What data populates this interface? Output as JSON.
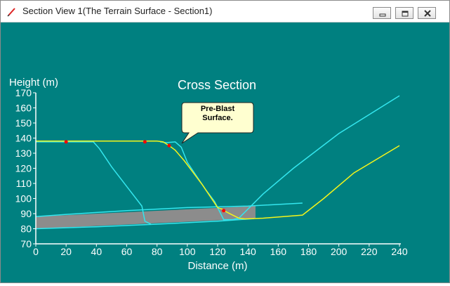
{
  "window": {
    "title": "Section View 1(The Terrain Surface - Section1)"
  },
  "title_buttons": [
    "minimize-icon",
    "restore-icon",
    "close-icon"
  ],
  "colors": {
    "background": "#008080",
    "surface_cyan": "#33e6ee",
    "surface_yellow": "#f5f51a",
    "layer_fill": "#8c8c8c",
    "marker_red": "#ff0000",
    "callout_fill": "#ffffd0"
  },
  "callout": {
    "line1": "Pre-Blast",
    "line2": "Surface."
  },
  "chart_data": {
    "type": "line",
    "title": "Cross Section",
    "xlabel": "Distance (m)",
    "ylabel": "Height (m)",
    "xlim": [
      0,
      240
    ],
    "ylim": [
      70,
      170
    ],
    "xticks": [
      0,
      20,
      40,
      60,
      80,
      100,
      120,
      140,
      160,
      180,
      200,
      220,
      240
    ],
    "yticks": [
      70,
      80,
      90,
      100,
      110,
      120,
      130,
      140,
      150,
      160,
      170
    ],
    "series": [
      {
        "color": "cyan",
        "points": [
          [
            0,
            137.5
          ],
          [
            38,
            137.5
          ],
          [
            42,
            133
          ],
          [
            50,
            121
          ],
          [
            60,
            108
          ],
          [
            70,
            95
          ],
          [
            72,
            85
          ],
          [
            76,
            83
          ]
        ]
      },
      {
        "color": "cyan",
        "points": [
          [
            82,
            137.5
          ],
          [
            86,
            137
          ],
          [
            92,
            137.5
          ],
          [
            96,
            134
          ],
          [
            100,
            124
          ],
          [
            106,
            115
          ],
          [
            112,
            106
          ],
          [
            118,
            98
          ],
          [
            122,
            90
          ],
          [
            124,
            86
          ],
          [
            130,
            86
          ],
          [
            134,
            87
          ],
          [
            140,
            93
          ],
          [
            150,
            103
          ],
          [
            170,
            120
          ],
          [
            200,
            143
          ],
          [
            240,
            168
          ]
        ]
      },
      {
        "color": "cyan",
        "points": [
          [
            0,
            88
          ],
          [
            20,
            89.5
          ],
          [
            60,
            92
          ],
          [
            100,
            94
          ],
          [
            140,
            95
          ],
          [
            176,
            97
          ]
        ]
      },
      {
        "color": "cyan",
        "points": [
          [
            0,
            80
          ],
          [
            40,
            81.3
          ],
          [
            80,
            83
          ],
          [
            120,
            85
          ],
          [
            144,
            86.7
          ]
        ]
      },
      {
        "color": "yellow",
        "points": [
          [
            0,
            138
          ],
          [
            80,
            138
          ],
          [
            84,
            137.5
          ],
          [
            88,
            135
          ],
          [
            92,
            132
          ],
          [
            98,
            125
          ],
          [
            104,
            117
          ],
          [
            110,
            109
          ],
          [
            114,
            103
          ],
          [
            118,
            97
          ],
          [
            120,
            94
          ],
          [
            123,
            93
          ],
          [
            126,
            91
          ],
          [
            130,
            89
          ],
          [
            134,
            87
          ],
          [
            138,
            86.5
          ],
          [
            150,
            87
          ],
          [
            176,
            89
          ],
          [
            190,
            100
          ],
          [
            210,
            117
          ],
          [
            240,
            135
          ]
        ]
      },
      {
        "color": "gray-band",
        "points": [
          [
            0,
            88
          ],
          [
            145,
            95
          ],
          [
            145,
            86.7
          ],
          [
            0,
            80
          ]
        ]
      }
    ],
    "markers": [
      [
        20,
        137.5
      ],
      [
        72,
        137.5
      ],
      [
        88,
        135
      ],
      [
        124,
        92
      ]
    ]
  }
}
